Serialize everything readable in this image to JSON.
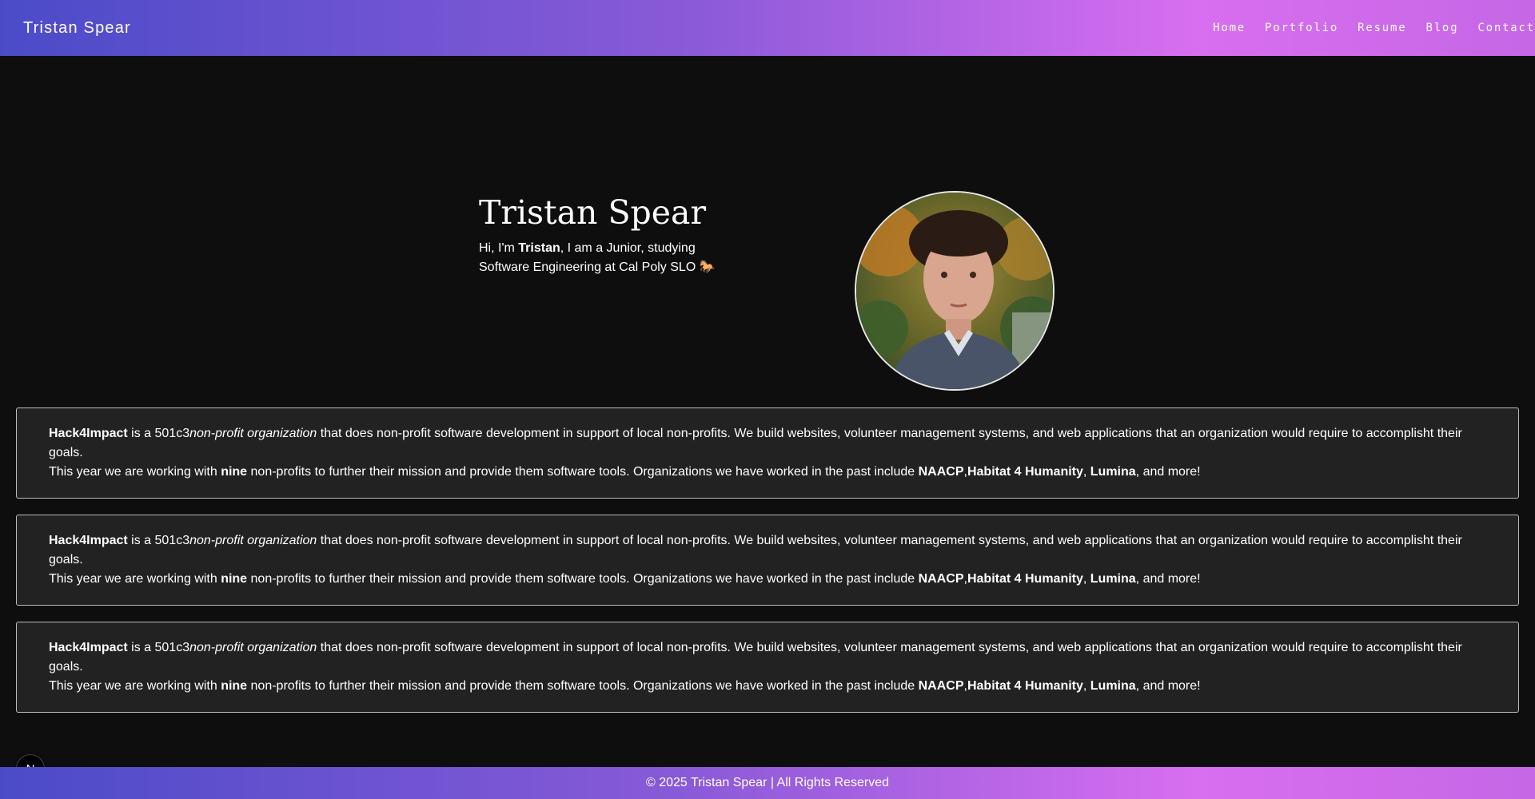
{
  "header": {
    "brand": "Tristan Spear",
    "nav": [
      "Home",
      "Portfolio",
      "Resume",
      "Blog",
      "Contact"
    ]
  },
  "hero": {
    "title": "Tristan Spear",
    "intro_prefix": "Hi, I'm ",
    "intro_name": "Tristan",
    "intro_suffix": ", I am a Junior, studying Software Engineering at Cal Poly SLO ",
    "intro_emoji": "🐎"
  },
  "cards": [
    {
      "org": "Hack4Impact",
      "l1a": " is a 501c3",
      "l1b": "non-profit organization",
      "l1c": " that does non-profit software development in support of local non-profits. We build websites, volunteer management systems, and web applications that an organization would require to accomplisht their goals.",
      "l2a": "This year we are working with ",
      "l2b": "nine",
      "l2c": " non-profits to further their mission and provide them software tools. Organizations we have worked in the past include ",
      "l2d": "NAACP",
      "l2e": ",",
      "l2f": "Habitat 4 Humanity",
      "l2g": ", ",
      "l2h": "Lumina",
      "l2i": ", and more!"
    },
    {
      "org": "Hack4Impact",
      "l1a": " is a 501c3",
      "l1b": "non-profit organization",
      "l1c": " that does non-profit software development in support of local non-profits. We build websites, volunteer management systems, and web applications that an organization would require to accomplisht their goals.",
      "l2a": "This year we are working with ",
      "l2b": "nine",
      "l2c": " non-profits to further their mission and provide them software tools. Organizations we have worked in the past include ",
      "l2d": "NAACP",
      "l2e": ",",
      "l2f": "Habitat 4 Humanity",
      "l2g": ", ",
      "l2h": "Lumina",
      "l2i": ", and more!"
    },
    {
      "org": "Hack4Impact",
      "l1a": " is a 501c3",
      "l1b": "non-profit organization",
      "l1c": " that does non-profit software development in support of local non-profits. We build websites, volunteer management systems, and web applications that an organization would require to accomplisht their goals.",
      "l2a": "This year we are working with ",
      "l2b": "nine",
      "l2c": " non-profits to further their mission and provide them software tools. Organizations we have worked in the past include ",
      "l2d": "NAACP",
      "l2e": ",",
      "l2f": "Habitat 4 Humanity",
      "l2g": ", ",
      "l2h": "Lumina",
      "l2i": ", and more!"
    }
  ],
  "footer": {
    "text": "© 2025 Tristan Spear | All Rights Reserved"
  },
  "next_badge": {
    "letter": "N"
  },
  "colors": {
    "gradient_start": "#4b4bc8",
    "gradient_mid": "#8a5ad8",
    "gradient_end": "#d86ef0",
    "background": "#0e0e0e",
    "card_bg": "#222222"
  }
}
